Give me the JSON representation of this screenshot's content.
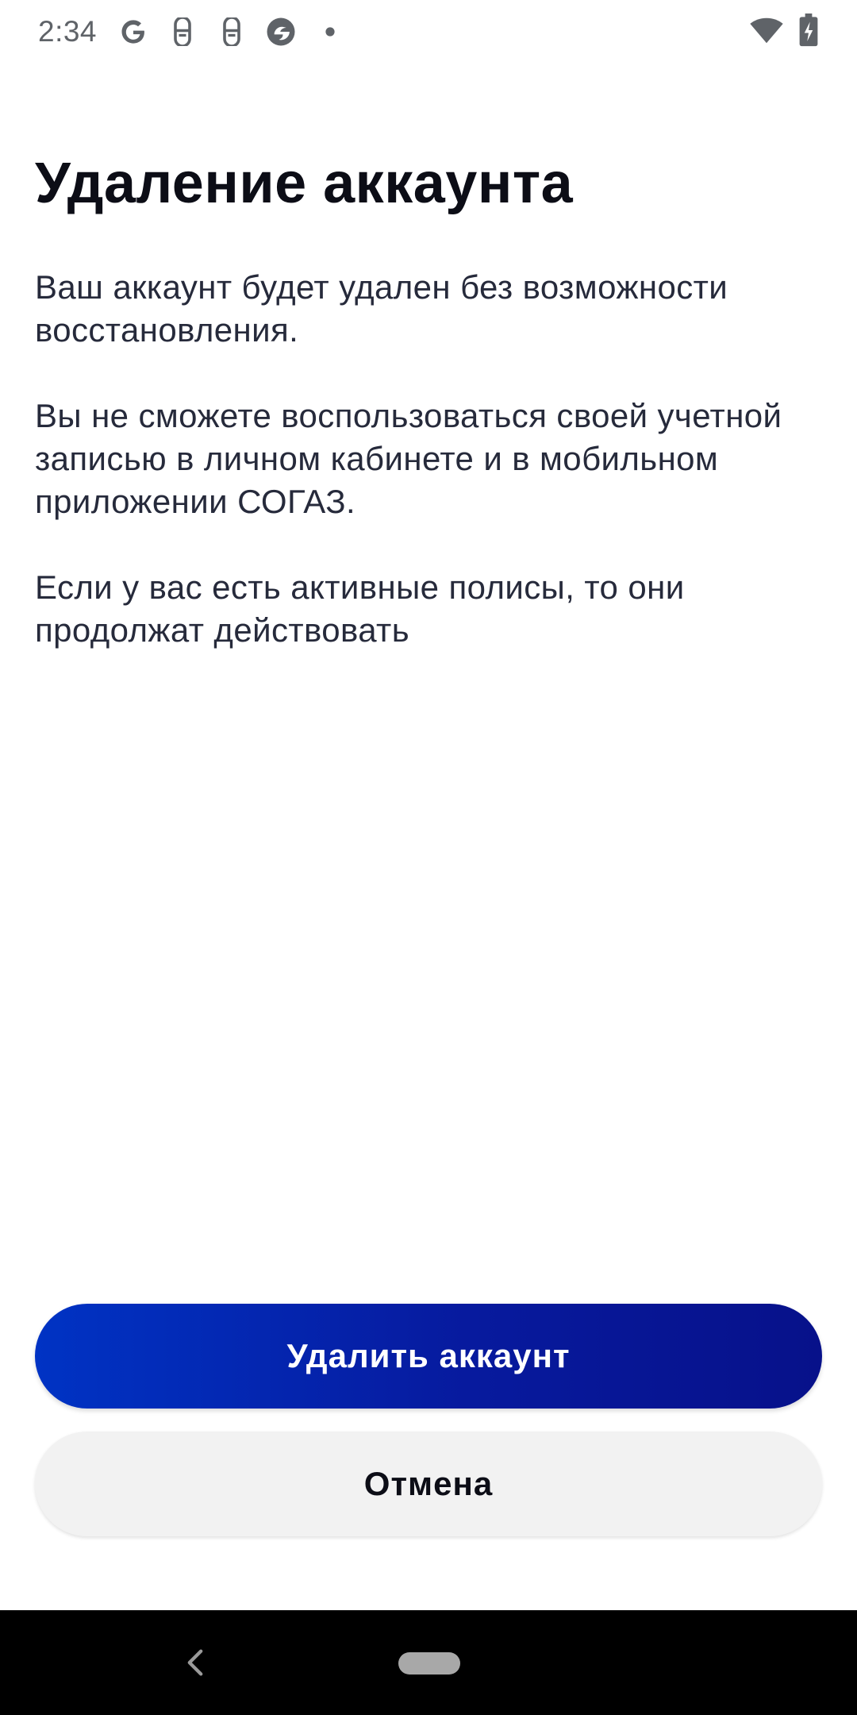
{
  "status_bar": {
    "time": "2:34",
    "left_icons": [
      "google-icon",
      "notification-app-icon",
      "notification-app-icon",
      "browser-icon",
      "dot-icon"
    ],
    "right_icons": [
      "wifi-icon",
      "battery-charging-icon"
    ]
  },
  "page": {
    "title": "Удаление аккаунта",
    "paragraphs": [
      "Ваш аккаунт будет удален без возможности восстановления.",
      "Вы не сможете воспользоваться своей учетной записью в личном кабинете и в мобильном приложении СОГАЗ.",
      "Если у вас есть активные полисы, то они продолжат действовать"
    ]
  },
  "actions": {
    "delete_label": "Удалить аккаунт",
    "cancel_label": "Отмена"
  },
  "colors": {
    "primary_gradient_start": "#0033c4",
    "primary_gradient_end": "#07118a",
    "secondary_button": "#f2f2f2",
    "text": "#262a3b"
  },
  "nav_bar": {
    "icons": [
      "back-icon",
      "home-pill-icon"
    ]
  }
}
